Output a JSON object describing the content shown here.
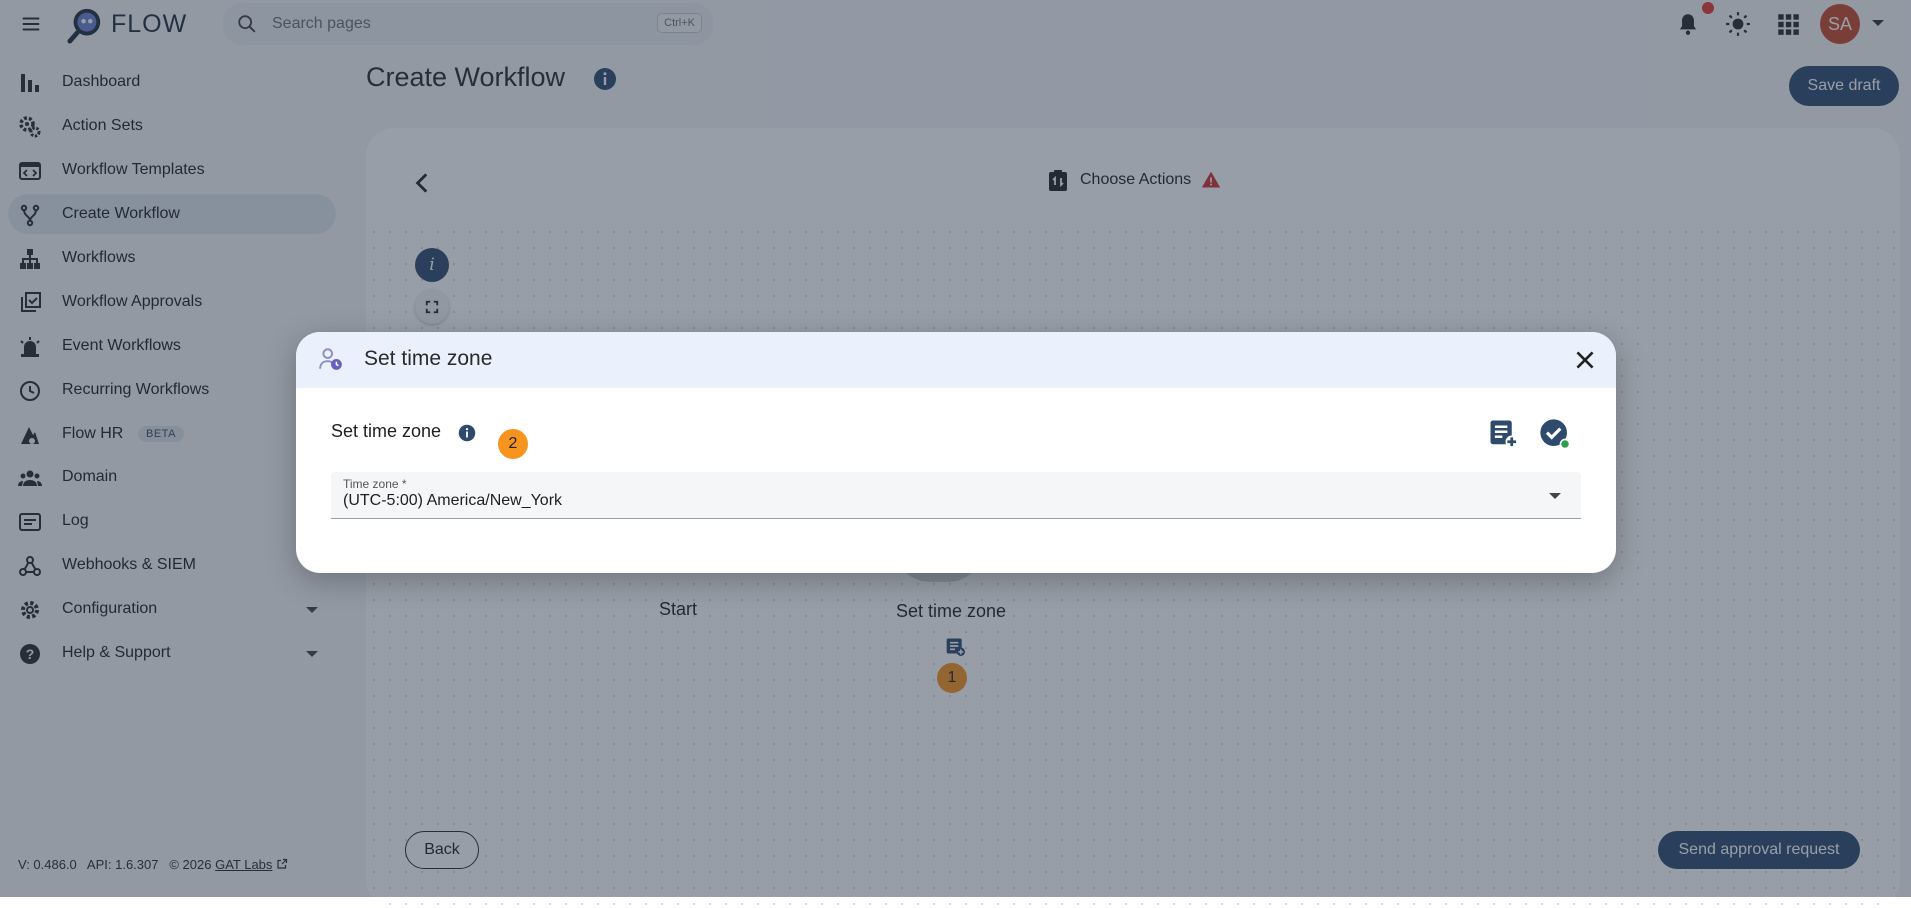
{
  "app": {
    "brand": "FLOW"
  },
  "search": {
    "placeholder": "Search pages",
    "shortcut": "Ctrl+K"
  },
  "user": {
    "initials": "SA",
    "avatar_color": "#c8472c"
  },
  "colors": {
    "primary": "#2e4a6d",
    "badge": "#f7941d",
    "notification": "#e53935",
    "warning": "#d32f2f"
  },
  "sidebar": {
    "items": [
      {
        "label": "Dashboard",
        "icon": "bar-chart-icon"
      },
      {
        "label": "Action Sets",
        "icon": "gears-icon"
      },
      {
        "label": "Workflow Templates",
        "icon": "template-icon"
      },
      {
        "label": "Create Workflow",
        "icon": "fork-icon",
        "active": true
      },
      {
        "label": "Workflows",
        "icon": "sitemap-icon"
      },
      {
        "label": "Workflow Approvals",
        "icon": "approval-icon"
      },
      {
        "label": "Event Workflows",
        "icon": "alarm-icon"
      },
      {
        "label": "Recurring Workflows",
        "icon": "clock-icon"
      },
      {
        "label": "Flow HR",
        "icon": "hr-icon",
        "badge": "BETA"
      },
      {
        "label": "Domain",
        "icon": "group-icon"
      },
      {
        "label": "Log",
        "icon": "log-icon"
      },
      {
        "label": "Webhooks & SIEM",
        "icon": "webhook-icon"
      },
      {
        "label": "Configuration",
        "icon": "gear-icon",
        "expandable": true
      },
      {
        "label": "Help & Support",
        "icon": "help-icon",
        "expandable": true
      }
    ]
  },
  "footer": {
    "version": "V: 0.486.0",
    "api": "API: 1.6.307",
    "copyright": "© 2026",
    "link": "GAT Labs"
  },
  "page": {
    "title": "Create Workflow",
    "save_draft": "Save draft"
  },
  "builder": {
    "step_label": "Choose Actions",
    "nodes": {
      "start": "Start",
      "action": "Set time zone"
    },
    "node_badge": "1",
    "back_button": "Back",
    "send_button": "Send approval request"
  },
  "modal": {
    "header_title": "Set time zone",
    "section_title": "Set time zone",
    "badge": "2",
    "field": {
      "label": "Time zone *",
      "value": "(UTC-5:00) America/New_York"
    }
  }
}
